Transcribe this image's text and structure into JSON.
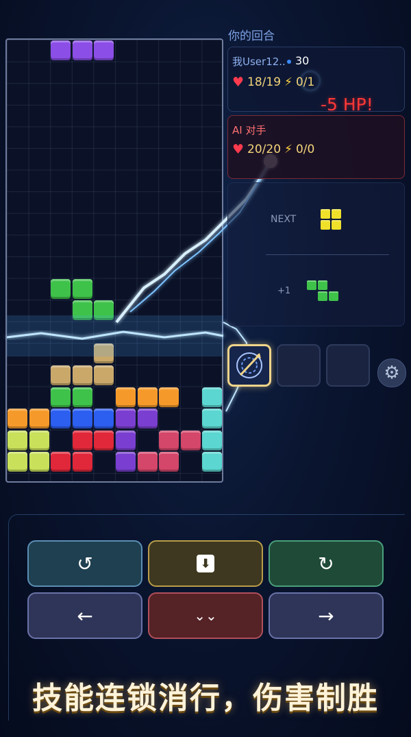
{
  "turn_label": "你的回合",
  "player": {
    "name": "我User12..",
    "score": "30",
    "hp": "18/19",
    "energy": "0/1"
  },
  "ai": {
    "name": "AI 对手",
    "hp": "20/20",
    "energy": "0/0"
  },
  "damage_text": "-5 HP!",
  "next_label": "NEXT",
  "plus_label": "+1",
  "controls": {
    "rotate_left_icon": "↺",
    "hard_drop_icon": "⬇",
    "rotate_right_icon": "↻",
    "move_left_icon": "←",
    "soft_drop_icon": "⌄⌄",
    "move_right_icon": "→"
  },
  "slogan": "技能连锁消行，伤害制胜",
  "colors": {
    "purple": "#8b4ee6",
    "green": "#3fc24a",
    "tan": "#c9a86a",
    "orange": "#f59a2a",
    "cyan": "#5bd6d0",
    "blue": "#2c5ef0",
    "yellowgreen": "#c8e05a",
    "red": "#e0283a",
    "pink": "#d4466a",
    "violet": "#7a3fd0",
    "yellow": "#f0e02a"
  },
  "board": {
    "cols": 10,
    "rows": 20,
    "cells": [
      {
        "c": 2,
        "r": 0,
        "color": "purple"
      },
      {
        "c": 3,
        "r": 0,
        "color": "purple"
      },
      {
        "c": 4,
        "r": 0,
        "color": "purple"
      },
      {
        "c": 2,
        "r": 11,
        "color": "green"
      },
      {
        "c": 3,
        "r": 11,
        "color": "green"
      },
      {
        "c": 3,
        "r": 12,
        "color": "green"
      },
      {
        "c": 4,
        "r": 12,
        "color": "green"
      },
      {
        "c": 4,
        "r": 14,
        "color": "tan"
      },
      {
        "c": 2,
        "r": 15,
        "color": "tan"
      },
      {
        "c": 3,
        "r": 15,
        "color": "tan"
      },
      {
        "c": 4,
        "r": 15,
        "color": "tan"
      },
      {
        "c": 2,
        "r": 16,
        "color": "green"
      },
      {
        "c": 3,
        "r": 16,
        "color": "green"
      },
      {
        "c": 5,
        "r": 16,
        "color": "orange"
      },
      {
        "c": 6,
        "r": 16,
        "color": "orange"
      },
      {
        "c": 7,
        "r": 16,
        "color": "orange"
      },
      {
        "c": 9,
        "r": 16,
        "color": "cyan"
      },
      {
        "c": 0,
        "r": 17,
        "color": "orange"
      },
      {
        "c": 1,
        "r": 17,
        "color": "orange"
      },
      {
        "c": 2,
        "r": 17,
        "color": "blue"
      },
      {
        "c": 3,
        "r": 17,
        "color": "blue"
      },
      {
        "c": 4,
        "r": 17,
        "color": "blue"
      },
      {
        "c": 5,
        "r": 17,
        "color": "violet"
      },
      {
        "c": 6,
        "r": 17,
        "color": "violet"
      },
      {
        "c": 9,
        "r": 17,
        "color": "cyan"
      },
      {
        "c": 0,
        "r": 18,
        "color": "yellowgreen"
      },
      {
        "c": 1,
        "r": 18,
        "color": "yellowgreen"
      },
      {
        "c": 3,
        "r": 18,
        "color": "red"
      },
      {
        "c": 4,
        "r": 18,
        "color": "red"
      },
      {
        "c": 5,
        "r": 18,
        "color": "violet"
      },
      {
        "c": 7,
        "r": 18,
        "color": "pink"
      },
      {
        "c": 8,
        "r": 18,
        "color": "pink"
      },
      {
        "c": 9,
        "r": 18,
        "color": "cyan"
      },
      {
        "c": 0,
        "r": 19,
        "color": "yellowgreen"
      },
      {
        "c": 1,
        "r": 19,
        "color": "yellowgreen"
      },
      {
        "c": 2,
        "r": 19,
        "color": "red"
      },
      {
        "c": 3,
        "r": 19,
        "color": "red"
      },
      {
        "c": 5,
        "r": 19,
        "color": "violet"
      },
      {
        "c": 6,
        "r": 19,
        "color": "pink"
      },
      {
        "c": 7,
        "r": 19,
        "color": "pink"
      },
      {
        "c": 9,
        "r": 19,
        "color": "cyan"
      }
    ]
  },
  "next_piece": {
    "shape": "O",
    "color": "yellow"
  },
  "queued_piece": {
    "shape": "Z",
    "color": "green"
  }
}
